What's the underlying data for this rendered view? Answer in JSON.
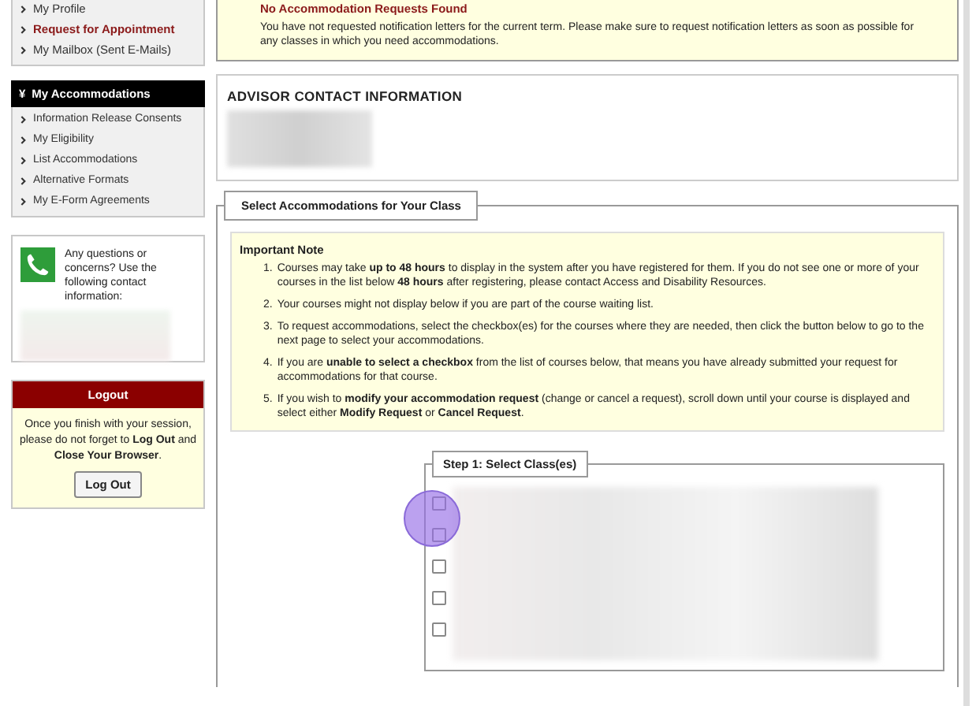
{
  "sidebar": {
    "top_links": [
      {
        "label": "My Profile",
        "selected": false
      },
      {
        "label": "Request for Appointment",
        "selected": true
      },
      {
        "label": "My Mailbox (Sent E-Mails)",
        "selected": false
      }
    ],
    "section": {
      "expand_icon": "¥",
      "title": "My Accommodations",
      "items": [
        "Information Release Consents",
        "My Eligibility",
        "List Accommodations",
        "Alternative Formats",
        "My E-Form Agreements"
      ]
    },
    "contact": {
      "text": "Any questions or concerns? Use the following contact information:"
    },
    "logout": {
      "title": "Logout",
      "text": "Once you finish with your session, please do not forget to **Log Out** and **Close Your Browser**.",
      "button": "Log Out"
    }
  },
  "alert": {
    "title": "No Accommodation Requests Found",
    "text": "You have not requested notification letters for the current term. Please make sure to request notification letters as soon as possible for any classes in which you need accommodations."
  },
  "advisor": {
    "title": "ADVISOR CONTACT INFORMATION"
  },
  "select_section": {
    "legend": "Select Accommodations for Your Class",
    "note_title": "Important Note",
    "notes": [
      {
        "number": "1.",
        "text": "Courses may take **up to 48 hours** to display in the system after you have registered for them. If you do not see one or more of your courses in the list below **48 hours** after registering, please contact Access and Disability Resources."
      },
      {
        "number": "2.",
        "text": "Your courses might not display below if you are part of the course waiting list."
      },
      {
        "number": "3.",
        "text": "To request accommodations, select the checkbox(es) for the courses where they are needed, then click the button below to go to the next page to select your accommodations."
      },
      {
        "number": "4.",
        "text": "If you are **unable to select a checkbox** from the list of courses below, that means you have already submitted your request for accommodations for that course."
      },
      {
        "number": "5.",
        "text": "If you wish to **modify your accommodation request** (change or cancel a request), scroll down until your course is displayed and select either **Modify Request** or **Cancel Request**."
      }
    ],
    "step": {
      "legend": "Step 1: Select Class(es)",
      "classes": [
        {
          "checked": false
        },
        {
          "checked": false
        },
        {
          "checked": false
        },
        {
          "checked": false
        },
        {
          "checked": false
        }
      ]
    }
  }
}
